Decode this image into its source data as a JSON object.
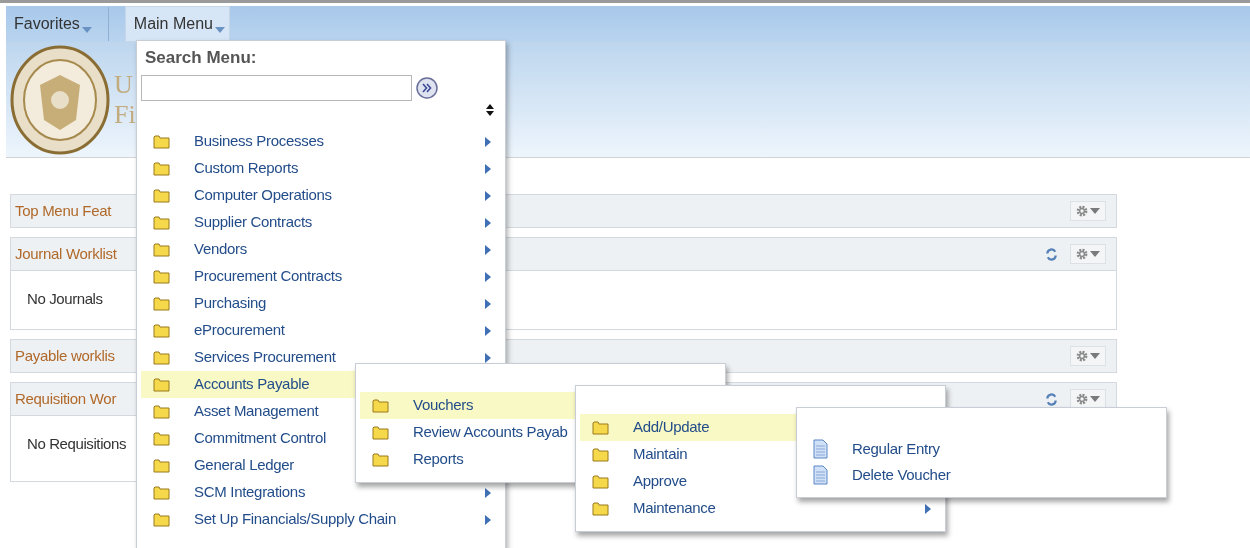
{
  "nav": {
    "tabs": [
      {
        "label": "Favorites",
        "selected": false
      },
      {
        "label": "Main Menu",
        "selected": true
      }
    ]
  },
  "header": {
    "title_lines": [
      "U",
      "Fi"
    ]
  },
  "pagelets": [
    {
      "title": "Top Menu Feat",
      "refresh": false
    },
    {
      "title": "Journal Worklist",
      "refresh": true,
      "body": "No Journals"
    },
    {
      "title": "Payable worklis",
      "refresh": false
    },
    {
      "title": "Requisition Wor",
      "refresh": true,
      "body": "No Requisitions"
    }
  ],
  "main_menu": {
    "search_label": "Search Menu:",
    "items": [
      {
        "label": "Business Processes",
        "kind": "folder",
        "selected": false,
        "arrow": true
      },
      {
        "label": "Custom Reports",
        "kind": "folder",
        "selected": false,
        "arrow": true
      },
      {
        "label": "Computer Operations",
        "kind": "folder",
        "selected": false,
        "arrow": true
      },
      {
        "label": "Supplier Contracts",
        "kind": "folder",
        "selected": false,
        "arrow": true
      },
      {
        "label": "Vendors",
        "kind": "folder",
        "selected": false,
        "arrow": true
      },
      {
        "label": "Procurement Contracts",
        "kind": "folder",
        "selected": false,
        "arrow": true
      },
      {
        "label": "Purchasing",
        "kind": "folder",
        "selected": false,
        "arrow": true
      },
      {
        "label": "eProcurement",
        "kind": "folder",
        "selected": false,
        "arrow": true
      },
      {
        "label": "Services Procurement",
        "kind": "folder",
        "selected": false,
        "arrow": true
      },
      {
        "label": "Accounts Payable",
        "kind": "folder",
        "selected": true
      },
      {
        "label": "Asset Management",
        "kind": "folder",
        "selected": false
      },
      {
        "label": "Commitment Control",
        "kind": "folder",
        "selected": false
      },
      {
        "label": "General Ledger",
        "kind": "folder",
        "selected": false
      },
      {
        "label": "SCM Integrations",
        "kind": "folder",
        "selected": false,
        "arrow": true
      },
      {
        "label": "Set Up Financials/Supply Chain",
        "kind": "folder",
        "selected": false,
        "arrow": true
      }
    ]
  },
  "submenus": [
    {
      "items": [
        {
          "label": "Vouchers",
          "kind": "folder",
          "selected": true
        },
        {
          "label": "Review Accounts Payab",
          "kind": "folder",
          "selected": false
        },
        {
          "label": "Reports",
          "kind": "folder",
          "selected": false
        }
      ]
    },
    {
      "items": [
        {
          "label": "Add/Update",
          "kind": "folder",
          "selected": true
        },
        {
          "label": "Maintain",
          "kind": "folder",
          "selected": false
        },
        {
          "label": "Approve",
          "kind": "folder",
          "selected": false
        },
        {
          "label": "Maintenance",
          "kind": "folder",
          "selected": false,
          "arrow": true
        }
      ]
    },
    {
      "items": [
        {
          "label": "Regular Entry",
          "kind": "page",
          "selected": false
        },
        {
          "label": "Delete Voucher",
          "kind": "page",
          "selected": false
        }
      ]
    }
  ]
}
